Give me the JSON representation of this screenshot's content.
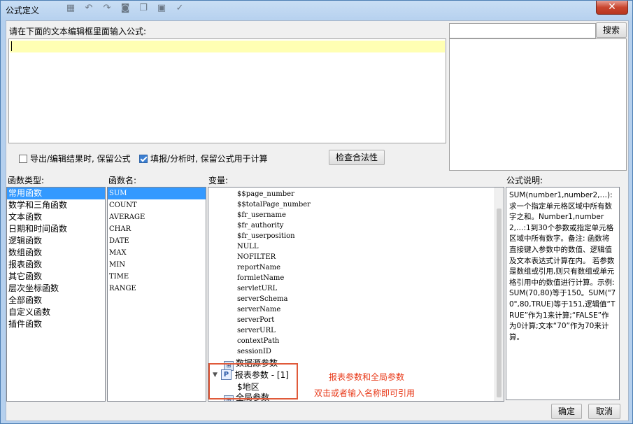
{
  "window": {
    "title": "公式定义",
    "close_label": "✕"
  },
  "toolbar_icons": [
    "grid-icon",
    "undo-icon",
    "redo-icon",
    "user-icon",
    "copy-icon",
    "paste-icon",
    "check-icon"
  ],
  "editor": {
    "prompt": "请在下面的文本编辑框里面输入公式:",
    "value": ""
  },
  "search": {
    "placeholder": "",
    "button": "搜索"
  },
  "options": {
    "export_keep": {
      "label": "导出/编辑结果时, 保留公式",
      "checked": false
    },
    "fill_keep": {
      "label": "填报/分析时, 保留公式用于计算",
      "checked": true
    },
    "check_button": "检查合法性"
  },
  "categories": {
    "label": "函数类型:",
    "items": [
      "常用函数",
      "数学和三角函数",
      "文本函数",
      "日期和时间函数",
      "逻辑函数",
      "数组函数",
      "报表函数",
      "其它函数",
      "层次坐标函数",
      "全部函数",
      "自定义函数",
      "插件函数"
    ],
    "selected": 0
  },
  "functions": {
    "label": "函数名:",
    "items": [
      "SUM",
      "COUNT",
      "AVERAGE",
      "CHAR",
      "DATE",
      "MAX",
      "MIN",
      "TIME",
      "RANGE"
    ],
    "selected": 0
  },
  "variables": {
    "label": "变量:",
    "items": [
      "$$page_number",
      "$$totalPage_number",
      "$fr_username",
      "$fr_authority",
      "$fr_userposition",
      "NULL",
      "NOFILTER",
      "reportName",
      "formletName",
      "servletURL",
      "serverSchema",
      "serverName",
      "serverPort",
      "serverURL",
      "contextPath",
      "sessionID"
    ],
    "datasource_node": "数据源参数",
    "report_params_node": "报表参数 - [1]",
    "report_param_item": "$地区",
    "global_params_node": "全局参数"
  },
  "annotation": {
    "line1": "报表参数和全局参数",
    "line2": "双击或者输入名称即可引用",
    "color": "#e83a1a"
  },
  "description": {
    "label": "公式说明:",
    "text": "SUM(number1,number2,…): 求一个指定单元格区域中所有数字之和。Number1,number2,…:1到30个参数或指定单元格区域中所有数字。备注: 函数将直接键入参数中的数值、逻辑值及文本表达式计算在内。 若参数是数组或引用,则只有数组或单元格引用中的数值进行计算。示例:SUM(70,80)等于150。SUM(\"70\",80,TRUE)等于151,逻辑值“TRUE”作为1来计算;“FALSE”作为0计算;文本“70”作为70来计算。"
  },
  "footer": {
    "ok": "确定",
    "cancel": "取消"
  }
}
